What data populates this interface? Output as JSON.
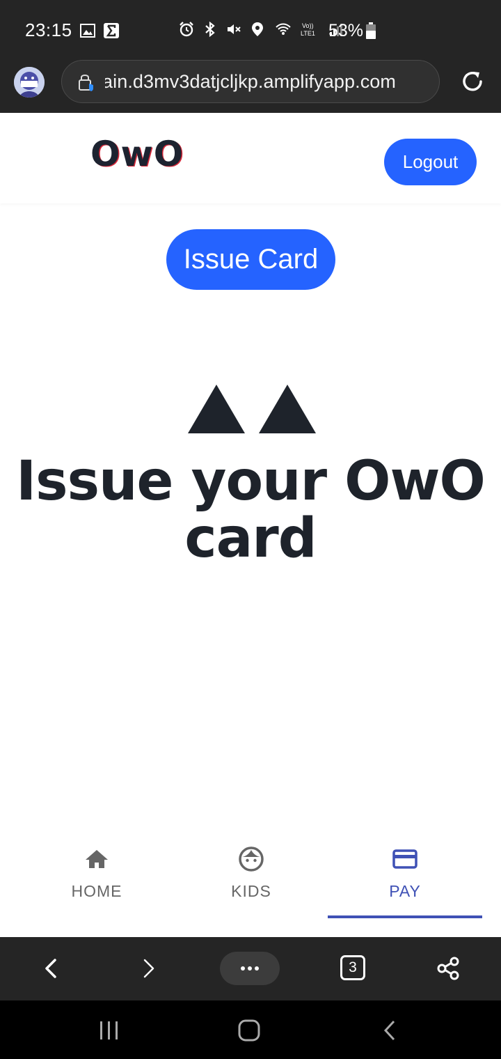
{
  "status_bar": {
    "time": "23:15",
    "battery": "53%",
    "icons": [
      "gallery-icon",
      "sigma-icon",
      "alarm-icon",
      "bluetooth-icon",
      "mute-icon",
      "location-icon",
      "wifi-icon",
      "volte-icon",
      "signal-icon",
      "battery-icon"
    ]
  },
  "browser": {
    "url": "ain.d3mv3datjcljkp.amplifyapp.com",
    "tab_count": "3"
  },
  "header": {
    "logo": "OwO",
    "logout_label": "Logout"
  },
  "main": {
    "issue_button_label": "Issue Card",
    "hero_title": "Issue your OwO card"
  },
  "bottom_nav": {
    "items": [
      {
        "label": "HOME",
        "icon": "home-icon"
      },
      {
        "label": "KIDS",
        "icon": "face-icon"
      },
      {
        "label": "PAY",
        "icon": "credit-card-icon"
      }
    ],
    "active": "PAY"
  },
  "colors": {
    "primary": "#2563ff",
    "nav_active": "#3f51b5",
    "text_dark": "#1e232b",
    "chrome_bg": "#252525"
  }
}
